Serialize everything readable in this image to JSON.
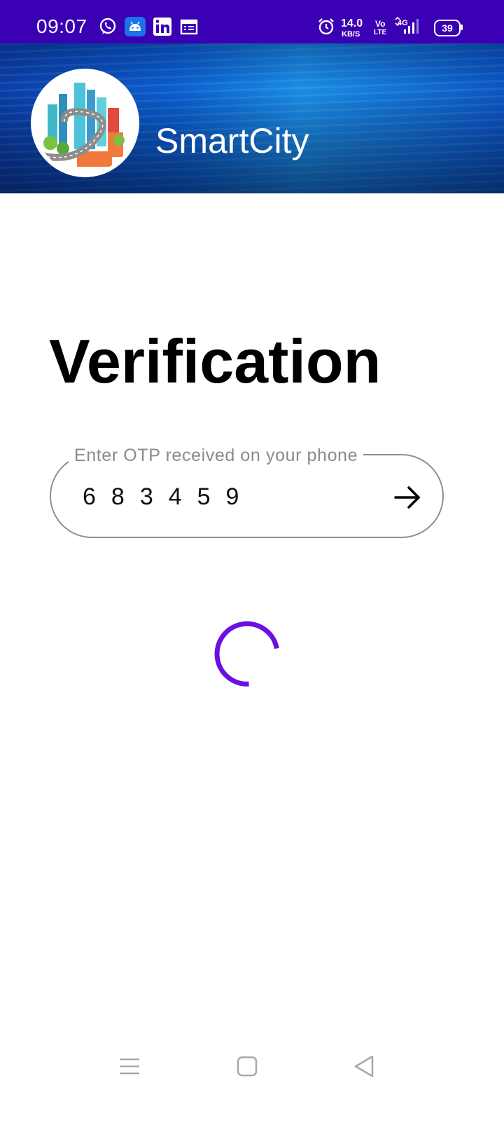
{
  "status_bar": {
    "time": "09:07",
    "net_speed_value": "14.0",
    "net_speed_unit": "KB/S",
    "volte_top": "Vo",
    "volte_bottom": "LTE",
    "network_type": "4G",
    "battery": "39",
    "icons": [
      "whatsapp-icon",
      "android-icon",
      "linkedin-icon",
      "calendar-icon",
      "alarm-icon",
      "signal-icon",
      "battery-icon"
    ]
  },
  "header": {
    "app_name": "SmartCity",
    "logo": "city-logo",
    "background_color": "#0a5fd0"
  },
  "main": {
    "title": "Verification",
    "otp_label": "Enter OTP received on your phone",
    "otp_value": "683459",
    "submit_icon": "arrow-right-icon",
    "loading": true,
    "accent_color": "#6a10e0"
  },
  "nav_bar": {
    "buttons": [
      "menu-icon",
      "home-icon",
      "back-icon"
    ]
  }
}
